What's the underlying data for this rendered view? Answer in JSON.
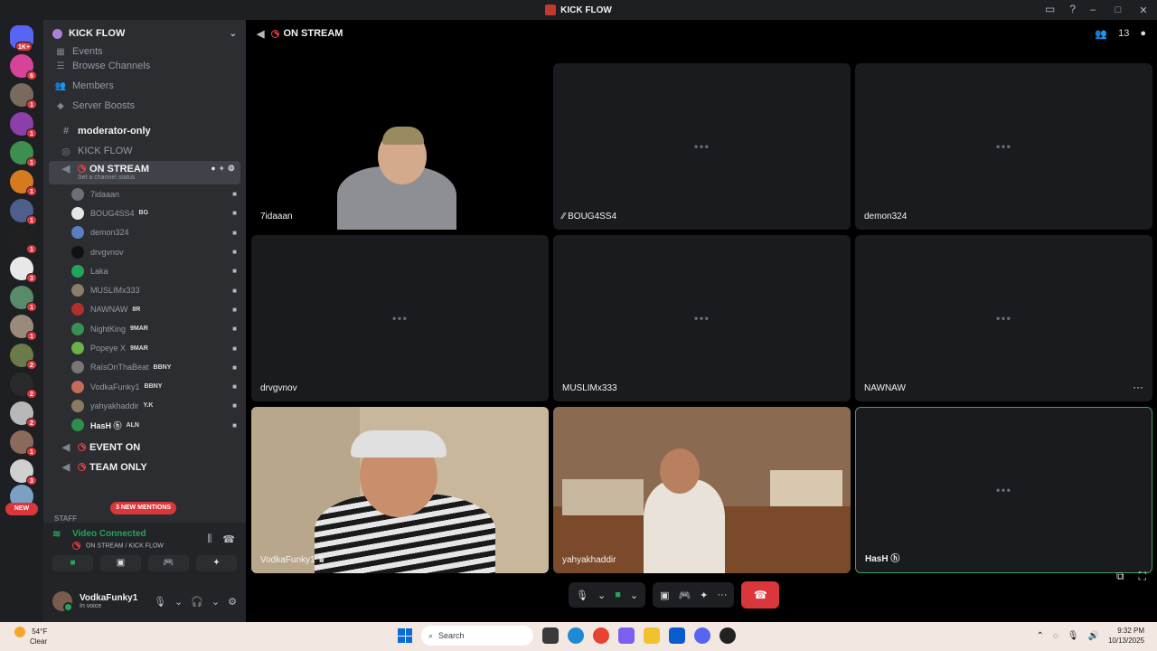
{
  "window": {
    "title": "KICK FLOW"
  },
  "servers": {
    "dm_badge": "1K+",
    "badges": [
      "6",
      "1",
      "1",
      "1",
      "1",
      "1",
      "1",
      "3",
      "1",
      "1",
      "2",
      "2",
      "2",
      "1",
      "3"
    ],
    "new_label": "NEW"
  },
  "guild": {
    "name": "KICK FLOW",
    "nav": [
      {
        "label": "Events",
        "icon": "calendar-icon"
      },
      {
        "label": "Browse Channels",
        "icon": "list-icon"
      },
      {
        "label": "Members",
        "icon": "members-icon"
      },
      {
        "label": "Server Boosts",
        "icon": "boost-icon"
      }
    ],
    "channels": {
      "moderator": "moderator-only",
      "kickflow": "KICK FLOW",
      "active": "ON STREAM",
      "active_status": "Set a channel status",
      "event": "EVENT ON",
      "team": "TEAM ONLY"
    },
    "voice_users": [
      {
        "name": "7idaaan",
        "tag": "",
        "color": "#6b6f78"
      },
      {
        "name": "BOUG4SS4",
        "tag": "BG",
        "color": "#e6e6e6"
      },
      {
        "name": "demon324",
        "tag": "",
        "color": "#5a7ec2"
      },
      {
        "name": "drvgvnov",
        "tag": "",
        "color": "#111111"
      },
      {
        "name": "Laka",
        "tag": "",
        "color": "#23a55a"
      },
      {
        "name": "MUSLIMx333",
        "tag": "",
        "color": "#8a7d6a"
      },
      {
        "name": "NAWNAW",
        "tag": "8R",
        "color": "#b03030"
      },
      {
        "name": "NightKing",
        "tag": "9MAR",
        "color": "#3b8f55"
      },
      {
        "name": "Popeye X",
        "tag": "9MAR",
        "color": "#6bb04a"
      },
      {
        "name": "RaïsOnThaBeat",
        "tag": "BBNY",
        "color": "#777777"
      },
      {
        "name": "VodkaFunky1",
        "tag": "BBNY",
        "color": "#c46b5a"
      },
      {
        "name": "yahyakhaddir",
        "tag": "Y.K",
        "color": "#8a7a60"
      },
      {
        "name": "HasH ⓗ",
        "tag": "ALN",
        "color": "#2f8f4a"
      }
    ],
    "mentions_label": "3 NEW MENTIONS",
    "staff_label": "STAFF"
  },
  "rtc": {
    "status": "Video Connected",
    "location": "ON STREAM / KICK FLOW"
  },
  "user": {
    "name": "VodkaFunky1",
    "status": "In voice"
  },
  "stage": {
    "channel": "ON STREAM",
    "member_count": "13",
    "tiles": [
      {
        "name": "7idaaan",
        "video": true
      },
      {
        "name": "BOUG4SS4",
        "video": false
      },
      {
        "name": "demon324",
        "video": false
      },
      {
        "name": "drvgvnov",
        "video": false
      },
      {
        "name": "MUSLIMx333",
        "video": false
      },
      {
        "name": "NAWNAW",
        "video": false
      },
      {
        "name": "VodkaFunky1",
        "video": true
      },
      {
        "name": "yahyakhaddir",
        "video": true
      },
      {
        "name": "HasH ⓗ",
        "video": false
      }
    ]
  },
  "taskbar": {
    "temp": "54°F",
    "condition": "Clear",
    "search_placeholder": "Search",
    "time": "9:32 PM",
    "date": "10/13/2025"
  },
  "colors": {
    "accent_green": "#23a55a",
    "danger_red": "#da373c",
    "sidebar_bg": "#2b2d31"
  }
}
